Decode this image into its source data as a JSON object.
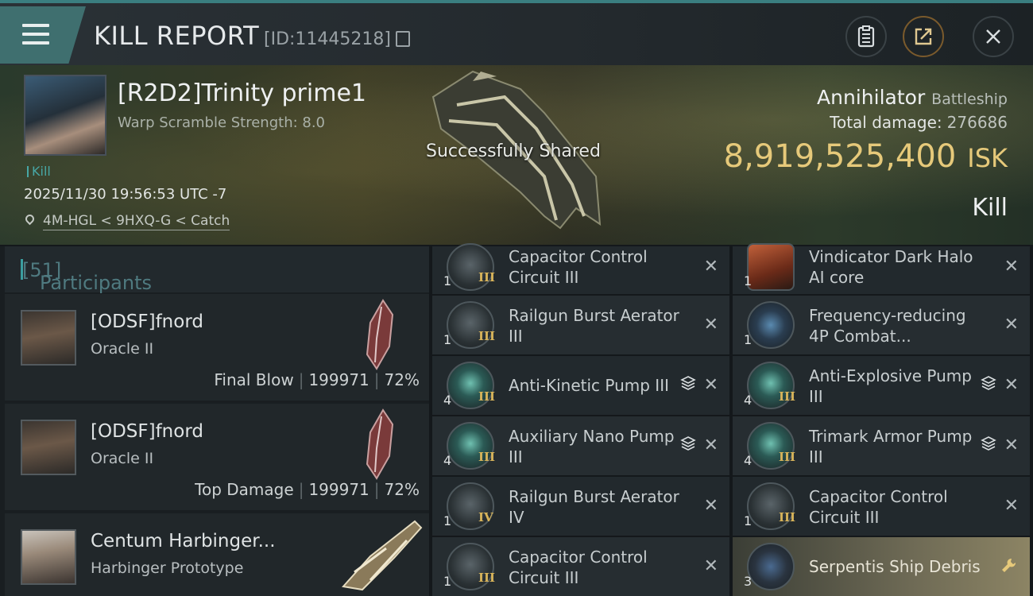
{
  "header": {
    "title": "KILL REPORT",
    "report_id": "[ID:11445218]"
  },
  "victim": {
    "name": "[R2D2]Trinity prime1",
    "warp_scramble": "Warp Scramble Strength: 8.0",
    "tag": "Kill",
    "datetime": "2025/11/30 19:56:53 UTC -7",
    "location": "4M-HGL < 9HXQ-G < Catch",
    "toast": "Successfully Shared",
    "ship": "Annihilator",
    "ship_class": "Battleship",
    "damage_label": "Total damage:",
    "damage_value": "276686",
    "isk_value": "8,919,525,400",
    "isk_unit": "ISK",
    "result": "Kill"
  },
  "participants": {
    "label": "Participants",
    "count": "[51]",
    "rows": [
      {
        "name": "[ODSF]fnord",
        "ship": "Oracle II",
        "role": "Final Blow",
        "damage": "199971",
        "percent": "72%"
      },
      {
        "name": "[ODSF]fnord",
        "ship": "Oracle II",
        "role": "Top Damage",
        "damage": "199971",
        "percent": "72%"
      },
      {
        "name": "Centum Harbinger...",
        "ship": "Harbinger Prototype"
      }
    ]
  },
  "items_left": [
    {
      "qty": "1",
      "tier": "III",
      "line1": "Capacitor Control",
      "line2": "Circuit III",
      "icon": "capacitor-icon"
    },
    {
      "qty": "1",
      "tier": "III",
      "line1": "Railgun Burst Aerator",
      "line2": "III",
      "icon": "railgun-icon"
    },
    {
      "qty": "4",
      "tier": "III",
      "line1": "Anti-Kinetic Pump III",
      "line2": "",
      "icon": "pump-icon"
    },
    {
      "qty": "4",
      "tier": "III",
      "line1": "Auxiliary Nano Pump",
      "line2": "III",
      "icon": "pump-icon"
    },
    {
      "qty": "1",
      "tier": "IV",
      "line1": "Railgun Burst Aerator",
      "line2": "IV",
      "icon": "railgun-icon"
    },
    {
      "qty": "1",
      "tier": "III",
      "line1": "Capacitor Control",
      "line2": "Circuit III",
      "icon": "capacitor-icon"
    }
  ],
  "items_right": [
    {
      "qty": "1",
      "tier": "",
      "line1": "Vindicator Dark Halo",
      "line2": "AI core",
      "icon": "ai-core-icon"
    },
    {
      "qty": "1",
      "tier": "",
      "line1": "Frequency-reducing",
      "line2": "4P Combat...",
      "icon": "frequency-icon"
    },
    {
      "qty": "4",
      "tier": "III",
      "line1": "Anti-Explosive Pump",
      "line2": "III",
      "icon": "pump-icon"
    },
    {
      "qty": "4",
      "tier": "III",
      "line1": "Trimark Armor Pump",
      "line2": "III",
      "icon": "pump-icon"
    },
    {
      "qty": "1",
      "tier": "III",
      "line1": "Capacitor Control",
      "line2": "Circuit III",
      "icon": "capacitor-icon"
    },
    {
      "qty": "3",
      "tier": "",
      "line1": "Serpentis Ship Debris",
      "line2": "",
      "icon": "debris-icon"
    }
  ],
  "colors": {
    "accent": "#3b9ea0",
    "isk": "#e6c97a",
    "tier": "#d8b45a"
  }
}
